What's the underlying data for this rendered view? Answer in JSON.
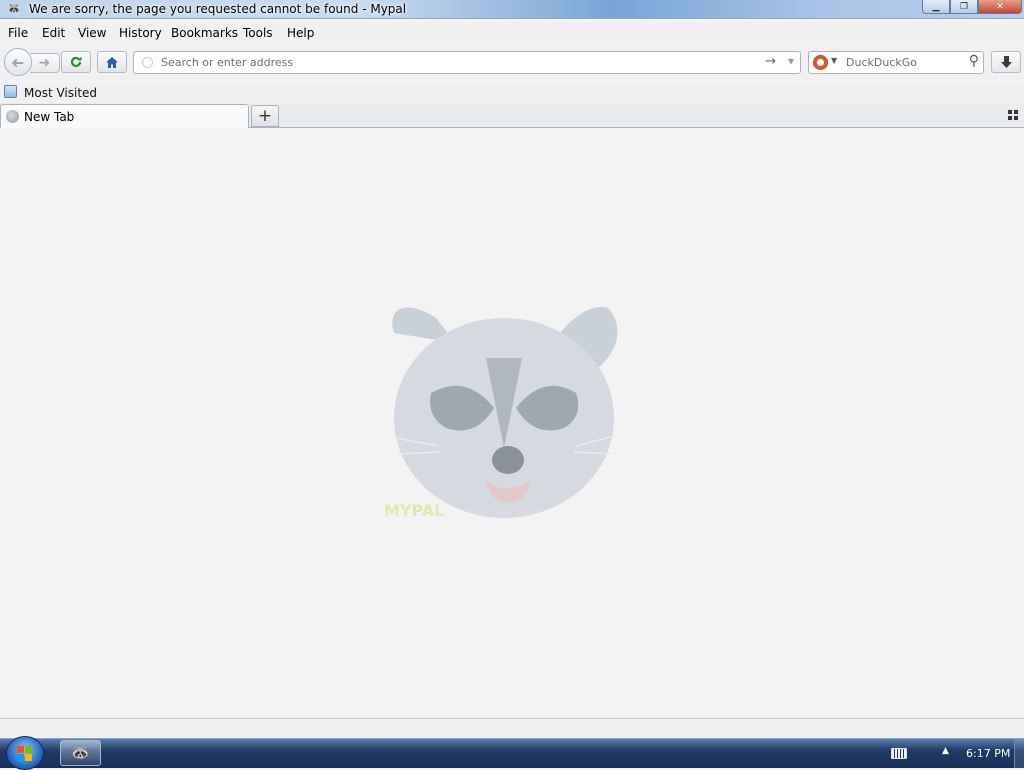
{
  "window": {
    "title": "We are sorry, the page you requested cannot be found - Mypal",
    "app_icon": "raccoon-icon"
  },
  "menu": {
    "items": [
      {
        "label": "File"
      },
      {
        "label": "Edit"
      },
      {
        "label": "View"
      },
      {
        "label": "History"
      },
      {
        "label": "Bookmarks"
      },
      {
        "label": "Tools"
      },
      {
        "label": "Help"
      }
    ]
  },
  "navbar": {
    "url_placeholder": "Search or enter address",
    "url_value": "",
    "search_engine": "DuckDuckGo",
    "search_placeholder": "DuckDuckGo"
  },
  "bookmarks": {
    "items": [
      {
        "label": "Most Visited"
      }
    ]
  },
  "tabs": [
    {
      "label": "New Tab",
      "active": true
    }
  ],
  "content": {
    "mascot": "raccoon-face-logo",
    "mascot_caption": "MYPAL"
  },
  "taskbar": {
    "clock": "6:17 PM"
  },
  "colors": {
    "titlebar": "#bfd3ea",
    "content_bg": "#f3f3f3",
    "taskbar": "#1f3a66",
    "duckduckgo": "#de5833"
  }
}
